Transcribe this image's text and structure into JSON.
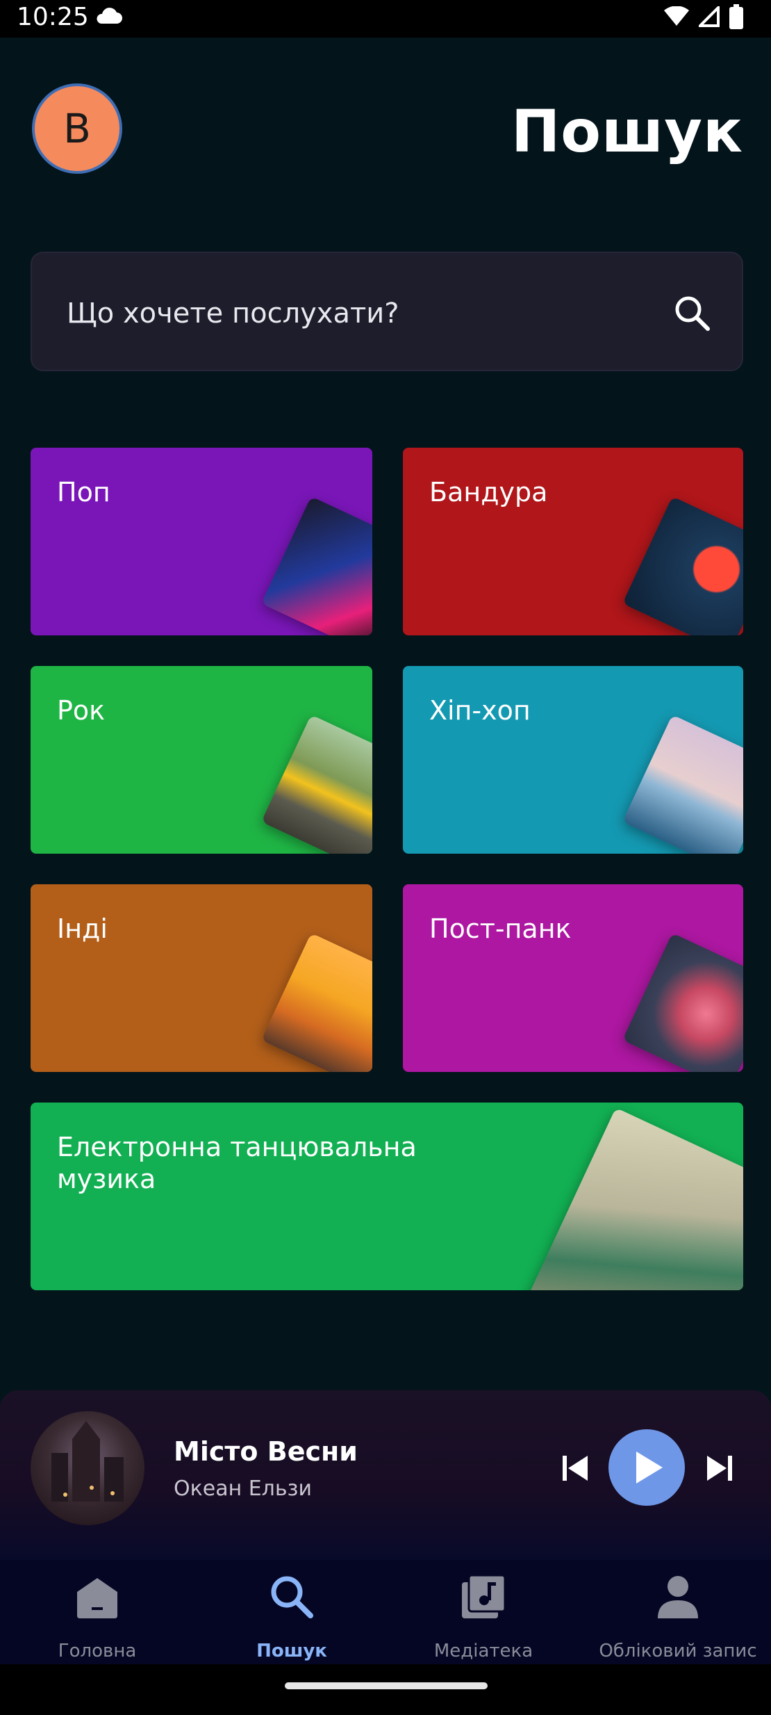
{
  "status": {
    "time": "10:25"
  },
  "header": {
    "avatar_letter": "B",
    "title": "Пошук"
  },
  "search": {
    "placeholder": "Що хочете послухати?"
  },
  "genres": [
    {
      "label": "Поп",
      "color": "#7a16b8"
    },
    {
      "label": "Бандура",
      "color": "#b0161a"
    },
    {
      "label": "Рок",
      "color": "#1fb545"
    },
    {
      "label": "Хіп-хоп",
      "color": "#1499b2"
    },
    {
      "label": "Інді",
      "color": "#b35f1a"
    },
    {
      "label": "Пост-панк",
      "color": "#ad17a1"
    },
    {
      "label": "Електронна танцювальна музика",
      "color": "#12b053"
    }
  ],
  "player": {
    "title": "Місто Весни",
    "artist": "Океан Ельзи"
  },
  "nav": {
    "items": [
      {
        "label": "Головна",
        "icon": "home-icon"
      },
      {
        "label": "Пошук",
        "icon": "search-icon",
        "active": true
      },
      {
        "label": "Медіатека",
        "icon": "library-icon"
      },
      {
        "label": "Обліковий запис",
        "icon": "account-icon"
      }
    ]
  },
  "colors": {
    "accent": "#8ab4f8",
    "play": "#6f97e8",
    "background": "#03141b"
  }
}
